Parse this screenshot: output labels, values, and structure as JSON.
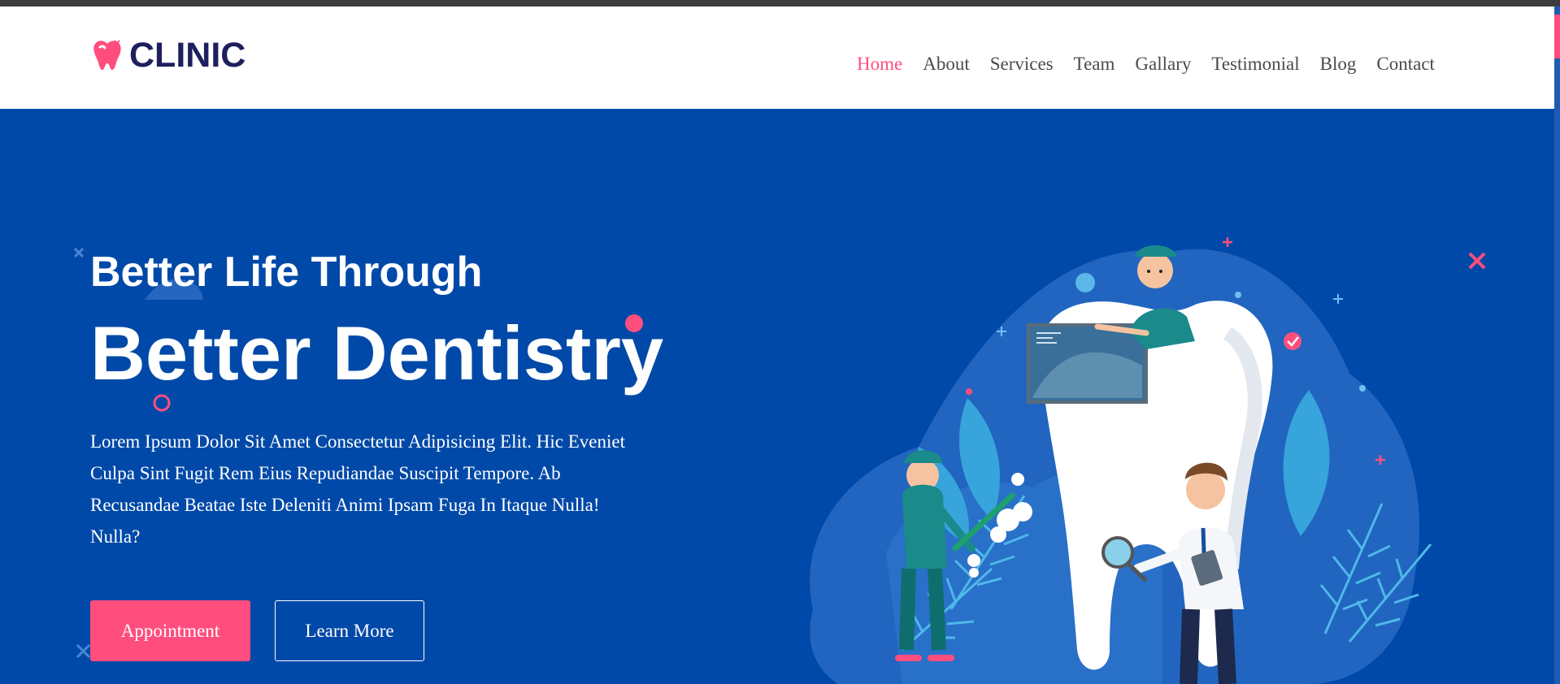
{
  "brand": {
    "name": "CLINIC",
    "icon": "tooth-logo-icon",
    "color_primary": "#1e1f5e",
    "color_accent": "#ff4e7d"
  },
  "nav": {
    "items": [
      {
        "label": "Home",
        "active": true
      },
      {
        "label": "About",
        "active": false
      },
      {
        "label": "Services",
        "active": false
      },
      {
        "label": "Team",
        "active": false
      },
      {
        "label": "Gallary",
        "active": false
      },
      {
        "label": "Testimonial",
        "active": false
      },
      {
        "label": "Blog",
        "active": false
      },
      {
        "label": "Contact",
        "active": false
      }
    ]
  },
  "hero": {
    "subtitle": "Better Life Through",
    "title": "Better Dentistry",
    "description": "Lorem Ipsum Dolor Sit Amet Consectetur Adipisicing Elit. Hic Eveniet Culpa Sint Fugit Rem Eius Repudiandae Suscipit Tempore. Ab Recusandae Beatae Iste Deleniti Animi Ipsam Fuga In Itaque Nulla! Nulla?",
    "appointment_label": "Appointment",
    "learn_more_label": "Learn More",
    "background_color": "#0049a8",
    "illustration": "dentists-with-giant-tooth-illustration"
  }
}
